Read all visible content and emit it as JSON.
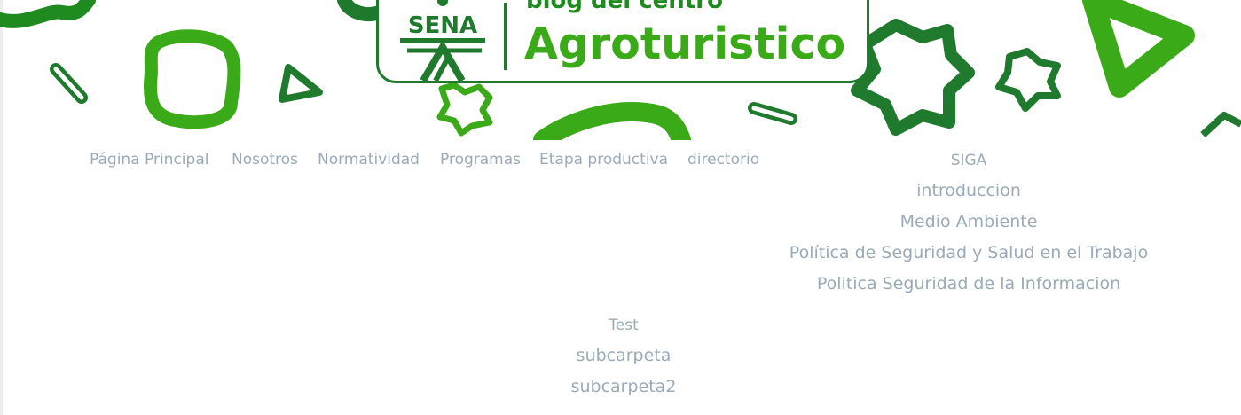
{
  "header": {
    "title_small": "blog del centro",
    "title_large": "Agroturistico",
    "logo_text": "SENA",
    "colors": {
      "dark_green": "#1f7a2e",
      "bright_green": "#3aaa18"
    }
  },
  "main_nav": [
    {
      "label": "Página Principal"
    },
    {
      "label": "Nosotros"
    },
    {
      "label": "Normatividad"
    },
    {
      "label": "Programas"
    },
    {
      "label": "Etapa productiva"
    },
    {
      "label": "directorio"
    }
  ],
  "siga_menu": [
    {
      "label": "SIGA"
    },
    {
      "label": "introduccion"
    },
    {
      "label": "Medio Ambiente"
    },
    {
      "label": "Política de Seguridad y Salud en el Trabajo"
    },
    {
      "label": "Politica Seguridad de la Informacion"
    }
  ],
  "test_menu": [
    {
      "label": "Test"
    },
    {
      "label": "subcarpeta"
    },
    {
      "label": "subcarpeta2"
    }
  ]
}
